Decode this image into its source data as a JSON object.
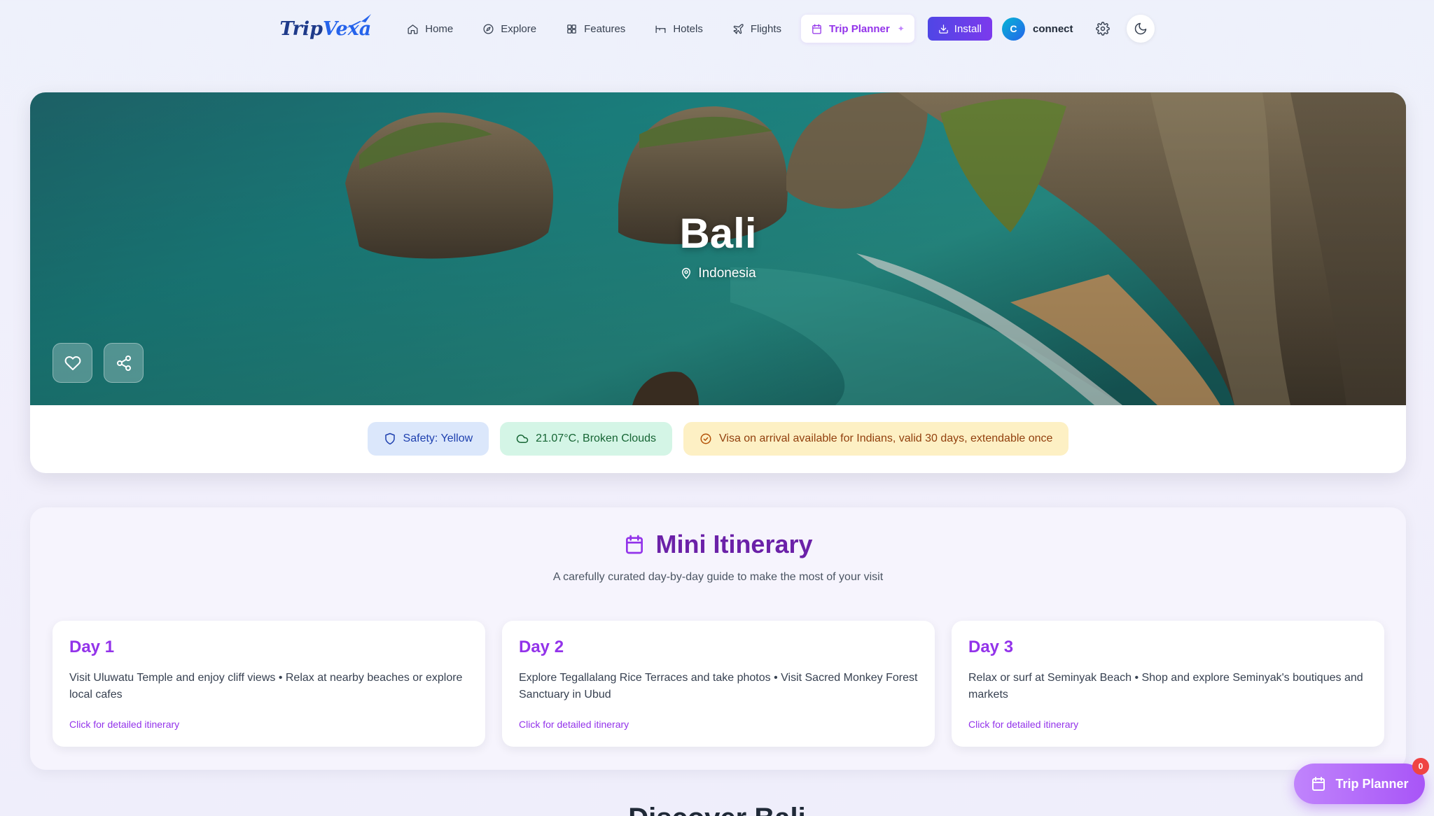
{
  "brand": {
    "name_part1": "Trip",
    "name_part2": "Vexa"
  },
  "nav": {
    "items": [
      {
        "label": "Home",
        "icon": "home-icon"
      },
      {
        "label": "Explore",
        "icon": "compass-icon"
      },
      {
        "label": "Features",
        "icon": "grid-icon"
      },
      {
        "label": "Hotels",
        "icon": "bed-icon"
      },
      {
        "label": "Flights",
        "icon": "plane-icon"
      }
    ],
    "active": {
      "label": "Trip Planner",
      "icon": "calendar-icon"
    },
    "install_label": "Install",
    "user": {
      "initial": "C",
      "name": "connect"
    }
  },
  "destination": {
    "name": "Bali",
    "country": "Indonesia",
    "badges": {
      "safety": "Safety: Yellow",
      "weather": "21.07°C, Broken Clouds",
      "visa": "Visa on arrival available for Indians, valid 30 days, extendable once"
    }
  },
  "itinerary": {
    "title": "Mini Itinerary",
    "subtitle": "A carefully curated day-by-day guide to make the most of your visit",
    "link_label": "Click for detailed itinerary",
    "days": [
      {
        "title": "Day 1",
        "desc": "Visit Uluwatu Temple and enjoy cliff views • Relax at nearby beaches or explore local cafes"
      },
      {
        "title": "Day 2",
        "desc": "Explore Tegallalang Rice Terraces and take photos • Visit Sacred Monkey Forest Sanctuary in Ubud"
      },
      {
        "title": "Day 3",
        "desc": "Relax or surf at Seminyak Beach • Shop and explore Seminyak's boutiques and markets"
      }
    ]
  },
  "next_section": {
    "heading": "Discover Bali"
  },
  "floating": {
    "label": "Trip Planner",
    "count": "0"
  },
  "colors": {
    "accent": "#9333ea",
    "brand": "#1e3a8a",
    "install": "#4f46e5"
  }
}
